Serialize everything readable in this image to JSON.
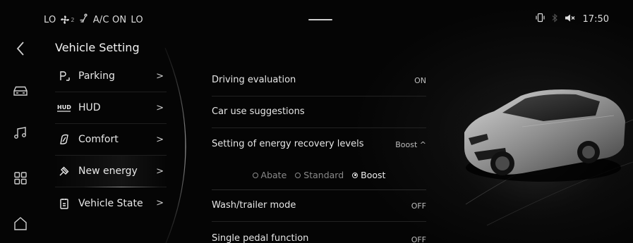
{
  "status_bar": {
    "temp_left": "LO",
    "fan_level": "2",
    "ac_status": "A/C ON",
    "temp_right": "LO",
    "time": "17:50",
    "icons": [
      "fan-icon",
      "airflow-icon",
      "phone-signal-icon",
      "bluetooth-icon",
      "mute-icon"
    ]
  },
  "rail": {
    "icons": [
      "back-icon",
      "car-icon",
      "music-icon",
      "apps-grid-icon",
      "home-icon"
    ]
  },
  "menu": {
    "title": "Vehicle Setting",
    "items": [
      {
        "label": "Parking",
        "icon": "parking-icon",
        "glyph": "P"
      },
      {
        "label": "HUD",
        "icon": "hud-icon",
        "glyph": "HUD"
      },
      {
        "label": "Comfort",
        "icon": "comfort-icon",
        "glyph": ""
      },
      {
        "label": "New energy",
        "icon": "new-energy-icon",
        "glyph": ""
      },
      {
        "label": "Vehicle State",
        "icon": "vehicle-state-icon",
        "glyph": ""
      }
    ],
    "active_index": 3
  },
  "settings": {
    "driving_evaluation": {
      "label": "Driving evaluation",
      "value": "ON"
    },
    "car_use_suggestions": {
      "label": "Car use suggestions"
    },
    "energy_recovery": {
      "label": "Setting of energy recovery levels",
      "value": "Boost",
      "options": [
        "Abate",
        "Standard",
        "Boost"
      ],
      "selected": "Boost"
    },
    "wash_trailer": {
      "label": "Wash/trailer mode",
      "value": "OFF"
    },
    "single_pedal": {
      "label": "Single pedal function",
      "value": "OFF"
    }
  },
  "colors": {
    "background": "#050505",
    "text": "#e6e6e6",
    "muted": "#8a8a8a"
  }
}
